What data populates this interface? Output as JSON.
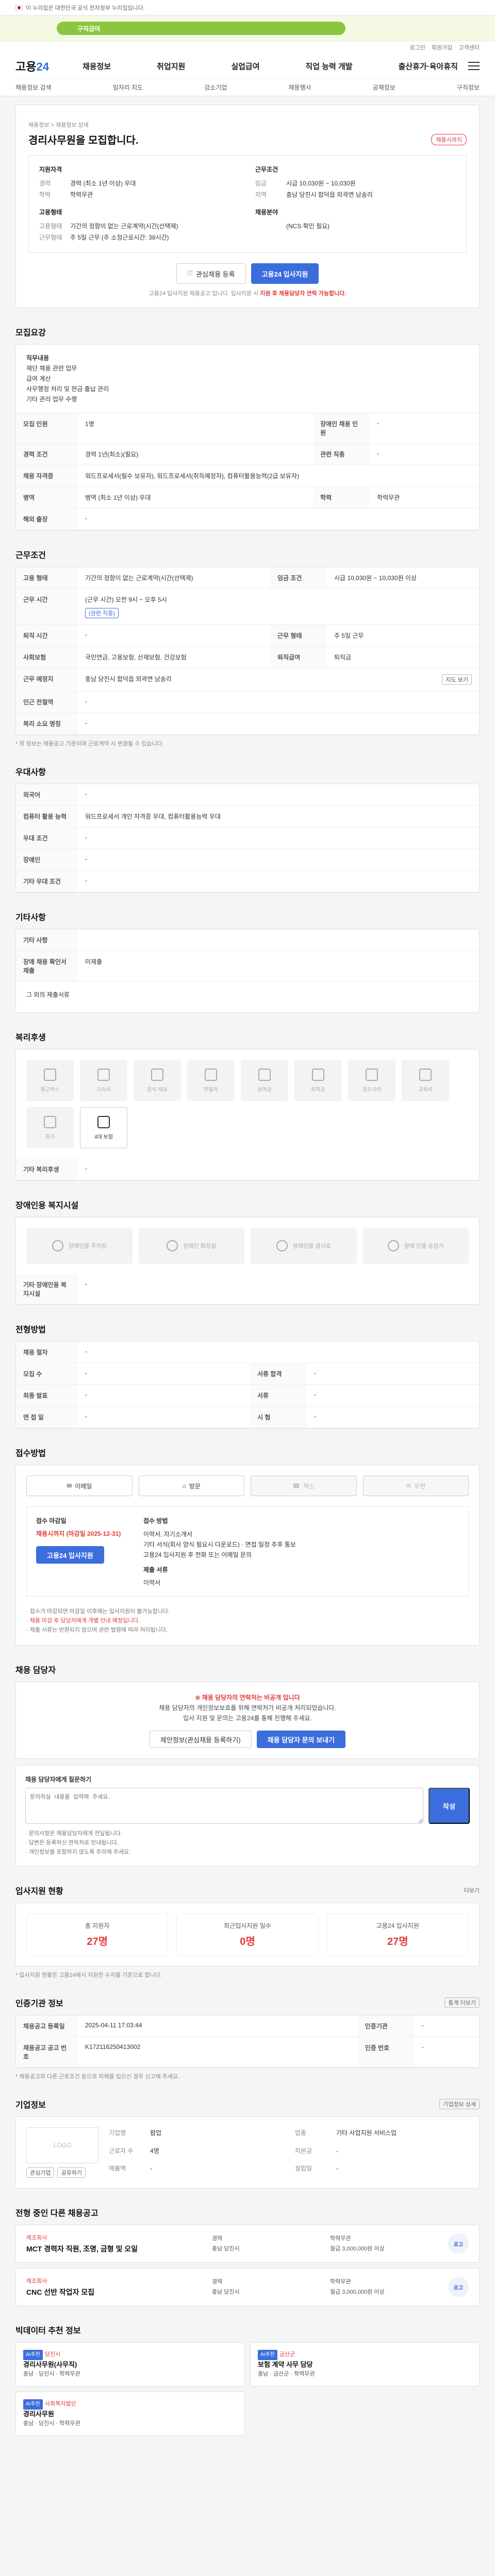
{
  "topbar": {
    "gov_text": "이 누리집은 대한민국 공식 전자정부 누리집입니다."
  },
  "banner": {
    "text": "구직급여"
  },
  "header": {
    "util": [
      "로그인",
      "회원가입",
      "고객센터"
    ],
    "logo_main": "고용",
    "logo_num": "24",
    "gnb": [
      "채용정보",
      "취업지원",
      "실업급여",
      "직업 능력 개발",
      "출산휴가·육아휴직"
    ],
    "subnav": [
      "채용정보 검색",
      "일자리 지도",
      "강소기업",
      "채용행사",
      "공채정보",
      "구직정보"
    ]
  },
  "job": {
    "breadcrumb": "채용정보 > 채용정보 상세",
    "title": "경리사무원을 모집합니다.",
    "badge": "채용시까지",
    "summary": {
      "left_title": "지원자격",
      "left": [
        {
          "k": "경력",
          "v": "경력 (최소 1년 이상) 우대"
        },
        {
          "k": "학력",
          "v": "학력무관"
        }
      ],
      "left2_title": "고용형태",
      "left2": [
        {
          "k": "고용형태",
          "v": "기간의 정함이 없는 근로계약(시간(선택제)"
        },
        {
          "k": "근무형태",
          "v": "주 5일 근무 (주 소정근로시간: 38시간)"
        }
      ],
      "right_title": "근무조건",
      "right": [
        {
          "k": "임금",
          "v": "시급 10,030원 ~ 10,030원"
        },
        {
          "k": "지역",
          "v": "충남 당진시 합덕읍 외곽면 남송리"
        }
      ],
      "right2_title": "채용분야",
      "right2": [
        {
          "k": "",
          "v": "(NCS 확인 필요)"
        }
      ]
    },
    "save_label": "관심채용 등록",
    "apply_label": "고용24 입사지원",
    "apply_note": "고용24 입사지원 채용공고 입니다. 입사지원 시",
    "apply_note_red": "지원 후 채용담당자 연락 가능합니다."
  },
  "sections": {
    "recruit": "모집요강",
    "conditions": "근무조건",
    "benefits": "우대사항",
    "etc": "기타사항",
    "welfare": "복리후생",
    "disability": "장애인용 복지시설",
    "process": "전형방법",
    "method": "접수방법",
    "manager": "채용 담당자",
    "stats": "입사지원 현황",
    "info": "인증기관 정보",
    "company": "기업정보",
    "related": "전형 중인 다른 채용공고",
    "ai": "빅데이터 추천 정보"
  },
  "recruit": {
    "duty_label": "직무내용",
    "duty_text": "재단 채용 관련 업무\n급여 계산\n사무행정 처리 및 현금 출납 관리\n기타 관리 업무 수행",
    "rows": [
      {
        "k": "모집 인원",
        "v": "1명",
        "k2": "장애인 채용 인원",
        "v2": "-"
      },
      {
        "k": "경력 조건",
        "v": "경력 1년(최소)(필요)",
        "k2": "관련 직종",
        "v2": "-"
      },
      {
        "k": "채용 자격증",
        "v": "워드프로세서(필수 보유자), 워드프로세서(취득예정자), 컴퓨터활용능력(2급 보유자)",
        "k2": "",
        "v2": ""
      },
      {
        "k": "병역",
        "v": "병역 (최소 1년 이상) 우대",
        "k2": "학력",
        "v2": "학력무관"
      },
      {
        "k": "해외 출장",
        "v": "-",
        "k2": "",
        "v2": ""
      }
    ]
  },
  "conditions": {
    "rows": [
      {
        "k": "고용 형태",
        "v": "기간의 정함이 없는 근로계약(시간(선택제)",
        "k2": "임금 조건",
        "v2": "시급 10,030원 ~ 10,030원 이상"
      },
      {
        "k": "근무 시간",
        "v": "(근무 시간) 오전 9시 ~ 오후 5시",
        "k2": "",
        "v2": ""
      },
      {
        "k": "퇴직 시간",
        "v": "-",
        "k2": "근무 형태",
        "v2": "주 5일 근무"
      },
      {
        "k": "사회보험",
        "v": "국민연금, 고용보험, 산재보험, 건강보험",
        "k2": "퇴직급여",
        "v2": "퇴직금"
      },
      {
        "k": "근무 예정지",
        "v": "충남 당진시 합덕읍 외곽면 남송리",
        "k2": "",
        "v2": ""
      },
      {
        "k": "인근 전철역",
        "v": "-",
        "k2": "",
        "v2": ""
      },
      {
        "k": "복리 소요 명칭",
        "v": "-",
        "k2": "",
        "v2": ""
      }
    ],
    "time_chip": "(관련 직종)",
    "map_btn": "지도 보기",
    "note": "* 위 정보는 채용공고 기준이며 근로계약 시 변경될 수 있습니다."
  },
  "benefits": {
    "rows": [
      {
        "k": "외국어",
        "v": "-"
      },
      {
        "k": "컴퓨터 활용 능력",
        "v": "워드프로세서 개인 자격증 우대, 컴퓨터활용능력 우대"
      },
      {
        "k": "우대 조건",
        "v": "-"
      },
      {
        "k": "장애인",
        "v": "-"
      },
      {
        "k": "기타 우대 조건",
        "v": "-"
      }
    ]
  },
  "etc": {
    "rows": [
      {
        "k": "기타 사항",
        "v": ""
      },
      {
        "k": "장애 채용 확인서 제출",
        "v": "미제출"
      }
    ],
    "extra": "그 외의 제출서류"
  },
  "welfare": {
    "items": [
      {
        "label": "통근버스",
        "on": false
      },
      {
        "label": "기숙사",
        "on": false
      },
      {
        "label": "중식 제공",
        "on": false
      },
      {
        "label": "연월차",
        "on": false
      },
      {
        "label": "상여금",
        "on": false
      },
      {
        "label": "퇴직금",
        "on": false
      },
      {
        "label": "경조사비",
        "on": false
      },
      {
        "label": "교육비",
        "on": false
      },
      {
        "label": "휴가",
        "on": false
      },
      {
        "label": "4대 보험",
        "on": true
      }
    ],
    "extra_label": "기타 복리후생",
    "extra_val": "-"
  },
  "disability": {
    "items": [
      "장애인용 주차장",
      "장애인 화장실",
      "장애인용 경사로",
      "장애 인용 승강기"
    ],
    "extra_label": "기타 장애인용 복지시설",
    "extra_val": "-"
  },
  "process": {
    "rows": [
      {
        "k": "채용 절차",
        "v": "-"
      },
      {
        "k": "모집 수",
        "v": "-",
        "k2": "서류 합격",
        "v2": "-"
      },
      {
        "k": "최종 발표",
        "v": "-",
        "k2": "서류",
        "v2": "-"
      },
      {
        "k": "면 접 일",
        "v": "-",
        "k2": "시 험",
        "v2": "-"
      }
    ]
  },
  "method": {
    "options": [
      {
        "label": "이메일",
        "on": true
      },
      {
        "label": "방문",
        "on": true
      },
      {
        "label": "팩스",
        "on": false
      },
      {
        "label": "우편",
        "on": false
      }
    ],
    "period_label": "접수 마감일",
    "period_val": "채용시까지 (마감일 2025-12-31)",
    "docs_label": "접수 방법",
    "docs_val": "이력서, 자기소개서\n기타 서식(회사 양식 필요시 다운로드) · 면접 일정 추후 통보\n고용24 입사지원 후 전화 또는 이메일 문의",
    "sel_label": "제출 서류",
    "sel_val": "이력서",
    "apply_btn": "고용24 입사지원",
    "notes": [
      "· 접수가 마감되면 마감일 이후에는 입사지원이 불가능합니다.",
      "· 채용 마감 후 담당자에게 개별 안내 예정입니다.",
      "· 제출 서류는 반환되지 않으며 관련 법령에 따라 처리됩니다."
    ]
  },
  "manager": {
    "warn": "채용 담당자의 연락처는 비공개 입니다",
    "text1": "채용 담당자의 개인정보보호를 위해 연락처가 비공개 처리되었습니다.",
    "text2": "입사 지원 및 문의는 고용24를 통해 진행해 주세요.",
    "btn1": "제안정보(관심채용 등록하기)",
    "btn2": "채용 담당자 문의 보내기",
    "q_title": "채용 담당자에게 질문하기",
    "q_placeholder": "문의하실 내용을 입력해 주세요.",
    "q_btn": "작성",
    "q_notes": [
      "· 문의사항은 채용담당자에게 전달됩니다.",
      "· 답변은 등록하신 연락처로 안내됩니다.",
      "· 개인정보를 포함하지 않도록 주의해 주세요."
    ]
  },
  "stats": {
    "more": "더보기",
    "items": [
      {
        "label": "총 지원자",
        "value": "27명"
      },
      {
        "label": "최근입사지원 일수",
        "value": "0명"
      },
      {
        "label": "고용24 입사지원",
        "value": "27명"
      }
    ],
    "note": "* 입사지원 현황은 고용24에서 지원한 수치를 기준으로 합니다."
  },
  "info": {
    "btn": "통계 더보기",
    "rows": [
      {
        "k": "채용공고 등록일",
        "v": "2025-04-11 17:03:44",
        "k2": "인증기관",
        "v2": "-"
      },
      {
        "k": "채용공고 공고 번호",
        "v": "K172116250413002",
        "k2": "인증 번호",
        "v2": "-"
      }
    ],
    "note": "* 채용공고와 다른 근로조건 등으로 피해를 입으신 경우 신고해 주세요."
  },
  "company": {
    "btn": "기업정보 상세",
    "logo": "LOGO",
    "rows": [
      {
        "k": "기업명",
        "v": "팝업"
      },
      {
        "k": "업종",
        "v": "기타 사업지원 서비스업"
      },
      {
        "k": "근로자 수",
        "v": "4명"
      },
      {
        "k": "자본금",
        "v": "-"
      },
      {
        "k": "매출액",
        "v": "-"
      },
      {
        "k": "설립일",
        "v": "-"
      }
    ],
    "follow": "관심기업",
    "share": "공유하기"
  },
  "related": [
    {
      "company": "제조회사",
      "title": "MCT 경력자 직원, 조명, 금형 및 오일",
      "tags": [
        "경력",
        "학력무관"
      ],
      "info1": "충남 당진시",
      "info2": "월급 3,000,000원 이상",
      "logo": "로고"
    },
    {
      "company": "제조회사",
      "title": "CNC 선반 작업자 모집",
      "tags": [
        "경력",
        "학력무관"
      ],
      "info1": "충남 당진시",
      "info2": "월급 3,000,000원 이상",
      "logo": "로고"
    }
  ],
  "ai": [
    {
      "company": "당진시",
      "title": "경리사무원(사무직)",
      "tag": "AI추천",
      "info": "충남 · 당진시 · 학력무관"
    },
    {
      "company": "금산군",
      "title": "보험 계약 사무 담당",
      "tag": "AI추천",
      "info": "충남 · 금산군 · 학력무관"
    },
    {
      "company": "사회복지법인",
      "title": "경리사무원",
      "tag": "AI추천",
      "info": "충남 · 당진시 · 학력무관"
    }
  ]
}
